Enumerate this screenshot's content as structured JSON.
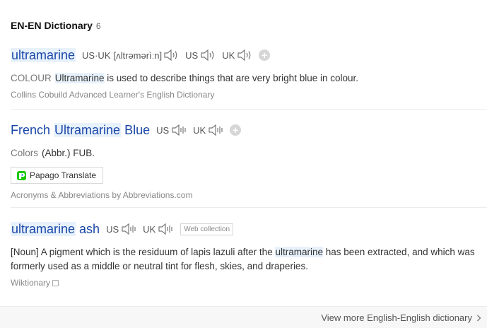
{
  "header": {
    "title": "EN-EN Dictionary",
    "count": "6"
  },
  "entries": [
    {
      "word": "ultramarine",
      "pron_us_uk_label": "US·UK",
      "ipa": "[ʌltrəmərìːn]",
      "us_label": "US",
      "uk_label": "UK",
      "category": "COLOUR",
      "def_highlight": "Ultramarine",
      "def_rest": " is used to describe things that are very bright blue in colour.",
      "source": "Collins Cobuild Advanced Learner's English Dictionary"
    },
    {
      "word_pre": "French ",
      "word_hl": "Ultramarine",
      "word_post": " Blue",
      "us_label": "US",
      "uk_label": "UK",
      "category": "Colors",
      "def": "(Abbr.) FUB.",
      "translate_button": "Papago Translate",
      "source": "Acronyms & Abbreviations by Abbreviations.com"
    },
    {
      "word_hl": "ultramarine",
      "word_post": " ash",
      "us_label": "US",
      "uk_label": "UK",
      "badge": "Web collection",
      "def_pre": "[Noun] A pigment which is the residuum of lapis lazuli after the ",
      "def_hl": "ultramarine",
      "def_post": " has been extracted, and which was formerly used as a middle or neutral tint for flesh, skies, and draperies.",
      "source": "Wiktionary"
    }
  ],
  "footer": {
    "more_link": "View more English-English dictionary"
  },
  "icons": {
    "speaker": "speaker-icon",
    "add": "plus-icon",
    "external": "external-link-icon",
    "chevron": "chevron-right-icon",
    "papago": "papago-logo-icon"
  },
  "colors": {
    "headword": "#1a47a8",
    "highlight": "#e8f2fc",
    "muted": "#888888"
  }
}
